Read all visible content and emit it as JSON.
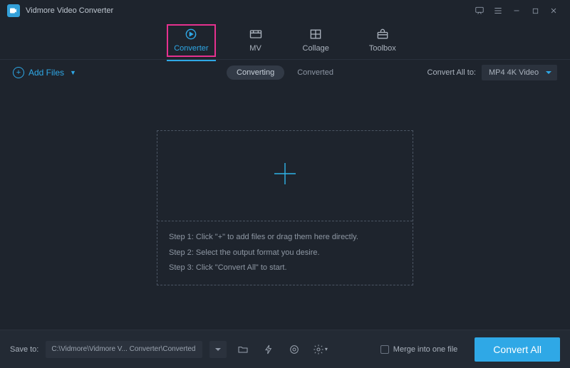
{
  "titlebar": {
    "app_name": "Vidmore Video Converter"
  },
  "main_tabs": {
    "converter": "Converter",
    "mv": "MV",
    "collage": "Collage",
    "toolbox": "Toolbox"
  },
  "subbar": {
    "add_files": "Add Files",
    "status": {
      "converting": "Converting",
      "converted": "Converted"
    },
    "convert_all_to_label": "Convert All to:",
    "format_selected": "MP4 4K Video"
  },
  "dropzone": {
    "step1": "Step 1: Click \"+\" to add files or drag them here directly.",
    "step2": "Step 2: Select the output format you desire.",
    "step3": "Step 3: Click \"Convert All\" to start."
  },
  "bottombar": {
    "save_to_label": "Save to:",
    "path": "C:\\Vidmore\\Vidmore V... Converter\\Converted",
    "merge_label": "Merge into one file",
    "convert_button": "Convert All"
  }
}
